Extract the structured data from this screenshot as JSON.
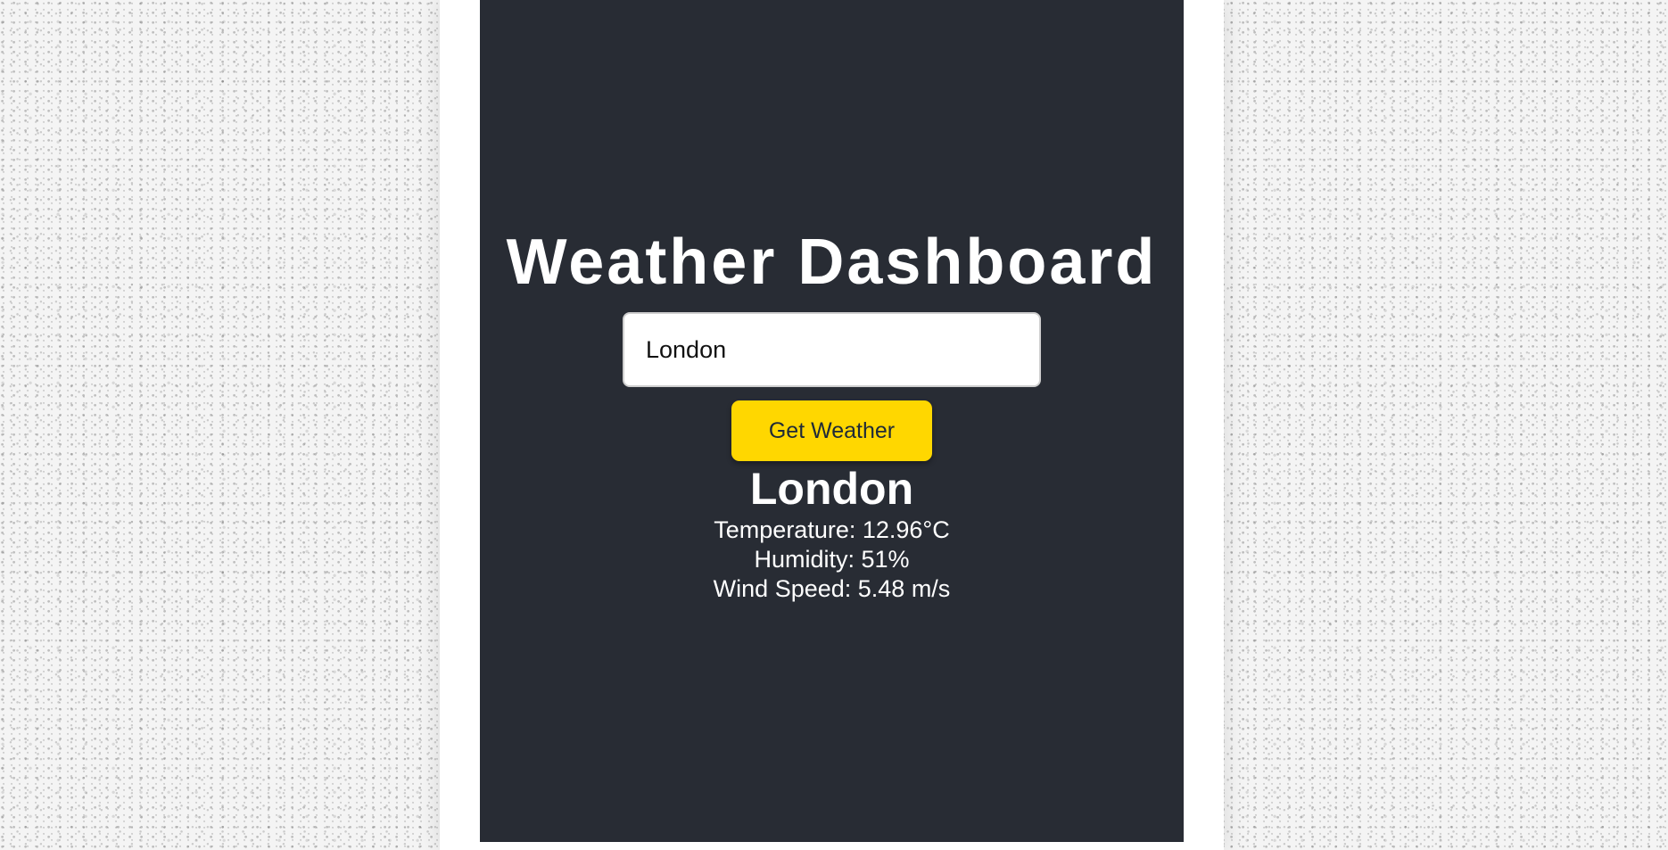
{
  "app": {
    "title": "Weather Dashboard"
  },
  "search": {
    "value": "London",
    "button_label": "Get Weather"
  },
  "result": {
    "city": "London",
    "temperature": "Temperature: 12.96°C",
    "humidity": "Humidity: 51%",
    "wind_speed": "Wind Speed: 5.48 m/s"
  },
  "colors": {
    "panel_background": "#282c34",
    "button_accent": "#ffd700",
    "text": "#ffffff"
  }
}
